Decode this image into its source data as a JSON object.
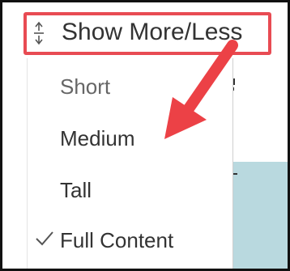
{
  "trigger": {
    "label": "Show More/Less",
    "icon": "expand-collapse-icon"
  },
  "menu": {
    "items": [
      {
        "label": "Short",
        "selected": false
      },
      {
        "label": "Medium",
        "selected": false
      },
      {
        "label": "Tall",
        "selected": false
      },
      {
        "label": "Full Content",
        "selected": true
      }
    ],
    "check_icon": "checkmark-icon"
  },
  "colors": {
    "highlight": "#e84b53",
    "arrow": "#ec4146",
    "text": "#333333",
    "background_panel": "#b9d9df"
  }
}
